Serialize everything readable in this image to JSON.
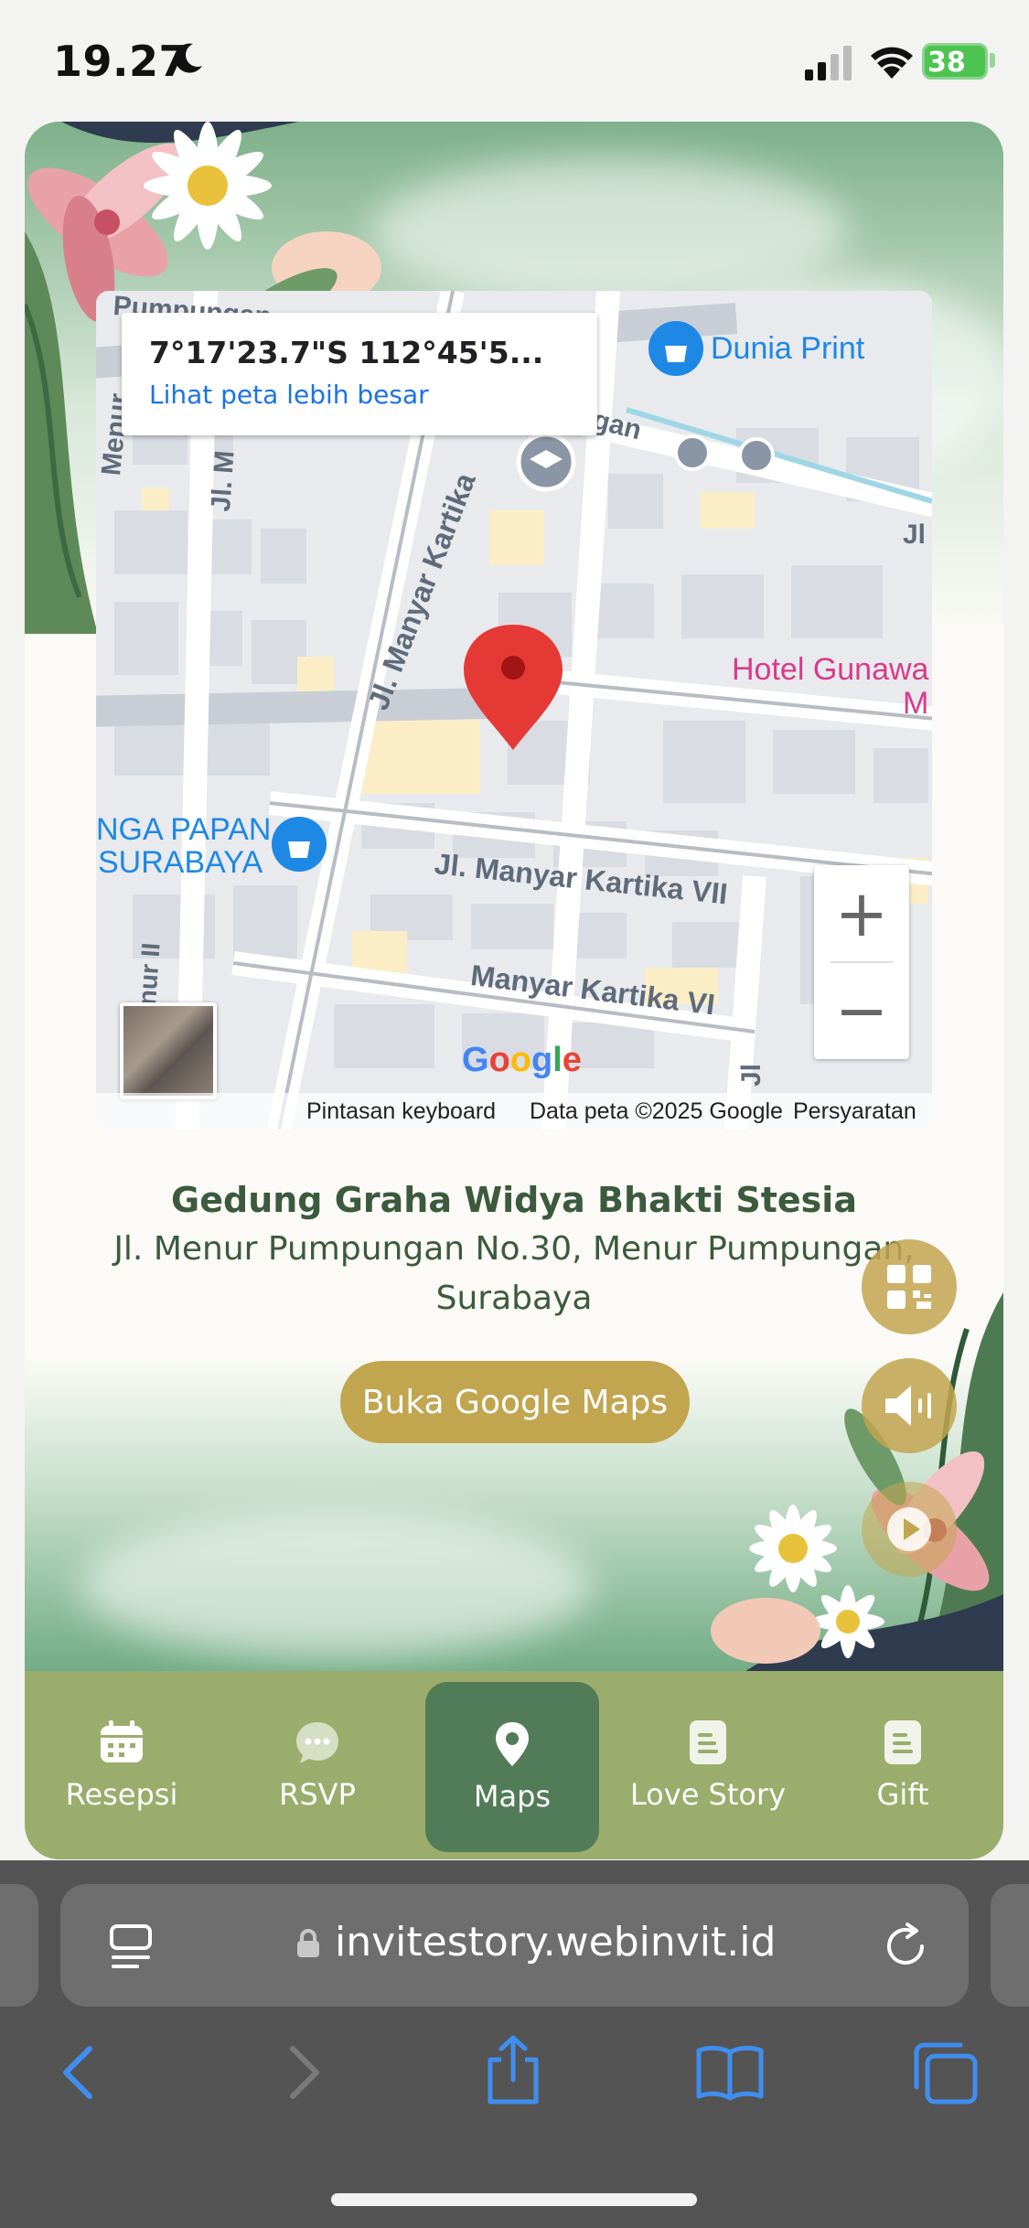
{
  "status_bar": {
    "time": "19.27",
    "battery": "38"
  },
  "map": {
    "coordinates": "7°17'23.7\"S 112°45'5...",
    "view_larger": "Lihat peta lebih besar",
    "labels": {
      "dunia_print": "Dunia Print",
      "hotel": "Hotel Gunawa",
      "hotel_2": "M",
      "papan": "NGA PAPAN",
      "surabaya": "SURABAYA",
      "street_vii": "Jl. Manyar Kartika VII",
      "street_vi": "Manyar Kartika VI",
      "street_diag": "Jl. Manyar Kartika",
      "street_top": "Pumpungan",
      "street_top2": "ngan",
      "street_left": "Menur",
      "street_left2": "Jl. M",
      "street_left3": "nur II",
      "street_right": "Jl",
      "street_bottom": "Jl"
    },
    "google_logo": "Google",
    "zoom_in": "+",
    "zoom_out": "−",
    "footer": {
      "shortcuts": "Pintasan keyboard",
      "data": "Data peta ©2025 Google",
      "terms": "Persyaratan"
    }
  },
  "venue": {
    "name": "Gedung Graha Widya Bhakti Stesia",
    "address": "Jl. Menur Pumpungan No.30, Menur Pumpungan, Surabaya",
    "open_maps": "Buka Google Maps"
  },
  "tabs": [
    {
      "label": "Resepsi",
      "icon": "calendar-icon"
    },
    {
      "label": "RSVP",
      "icon": "chat-icon"
    },
    {
      "label": "Maps",
      "icon": "map-pin-icon",
      "active": true
    },
    {
      "label": "Love Story",
      "icon": "document-icon"
    },
    {
      "label": "Gift",
      "icon": "document-icon"
    }
  ],
  "browser": {
    "url": "invitestory.webinvit.id"
  },
  "colors": {
    "accent_gold": "#c2a54f",
    "tab_bar": "#9aad6c",
    "tab_active": "#527c58",
    "venue_text": "#3c5a3e",
    "link_blue": "#1a73e8",
    "hotel_pink": "#d93a8a"
  }
}
